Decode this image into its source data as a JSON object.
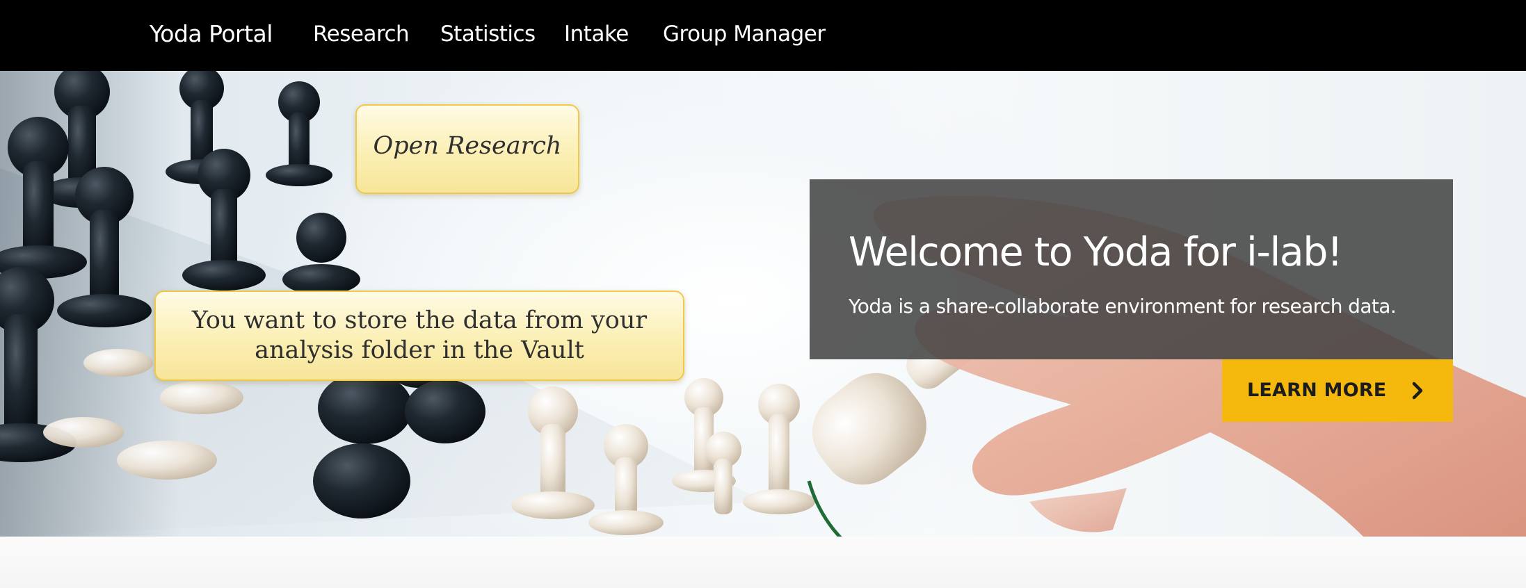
{
  "navbar": {
    "brand": "Yoda Portal",
    "items": [
      {
        "label": "Research"
      },
      {
        "label": "Statistics"
      },
      {
        "label": "Intake"
      },
      {
        "label": "Group Manager"
      }
    ]
  },
  "hero": {
    "title": "Welcome to Yoda for i-lab!",
    "subtitle": "Yoda is a share-collaborate environment for research data.",
    "cta_label": "LEARN MORE",
    "cta_icon": "chevron-right-icon",
    "background_image": "chess-pieces-hand-photo"
  },
  "callouts": {
    "open_research": "Open Research",
    "store_data_line1": "You want to store the data from your",
    "store_data_line2": "analysis folder in the Vault"
  },
  "colors": {
    "navbar_bg": "#000000",
    "accent": "#f5b90d",
    "panel_bg": "#414141",
    "callout_bg": "#fbefb4",
    "callout_border": "#f0c94a"
  }
}
